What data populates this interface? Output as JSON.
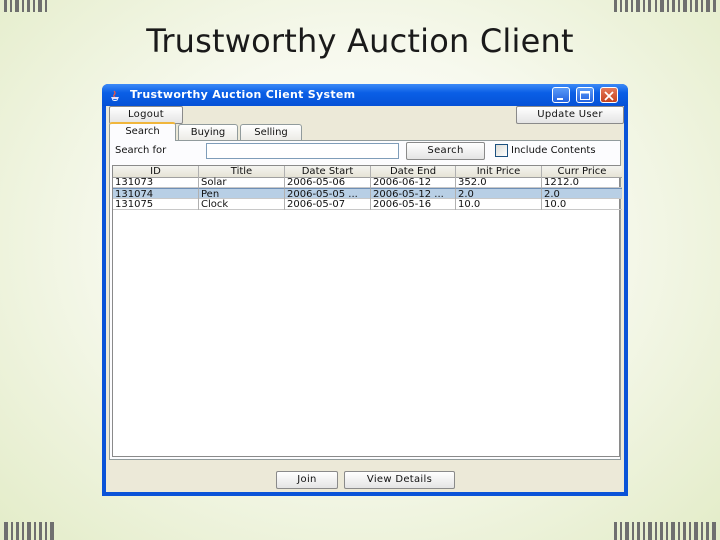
{
  "slide": {
    "title": "Trustworthy Auction Client"
  },
  "window": {
    "title": "Trustworthy Auction Client System",
    "controls": [
      "minimize-icon",
      "maximize-icon",
      "close-icon"
    ]
  },
  "toolbar": {
    "logout_label": "Logout",
    "update_user_label": "Update User"
  },
  "tabs": [
    {
      "label": "Search",
      "active": true
    },
    {
      "label": "Buying",
      "active": false
    },
    {
      "label": "Selling",
      "active": false
    }
  ],
  "search": {
    "label": "Search for",
    "query": "",
    "button_label": "Search",
    "include_contents_label": "Include Contents",
    "include_contents_checked": false
  },
  "table": {
    "columns": [
      "ID",
      "Title",
      "Date Start",
      "Date End",
      "Init Price",
      "Curr Price"
    ],
    "rows": [
      {
        "id": "131073",
        "title": "Solar",
        "date_start": "2006-05-06",
        "date_end": "2006-06-12",
        "init_price": "352.0",
        "curr_price": "1212.0",
        "selected": false
      },
      {
        "id": "131074",
        "title": "Pen",
        "date_start": "2006-05-05 ...",
        "date_end": "2006-05-12 ...",
        "init_price": "2.0",
        "curr_price": "2.0",
        "selected": true
      },
      {
        "id": "131075",
        "title": "Clock",
        "date_start": "2006-05-07",
        "date_end": "2006-05-16",
        "init_price": "10.0",
        "curr_price": "10.0",
        "selected": false
      }
    ]
  },
  "actions": {
    "join_label": "Join",
    "view_details_label": "View Details"
  },
  "colors": {
    "titlebar": "#0a5fe6",
    "selection": "#b8cfe5",
    "active_tab_accent": "#f0b63c"
  }
}
